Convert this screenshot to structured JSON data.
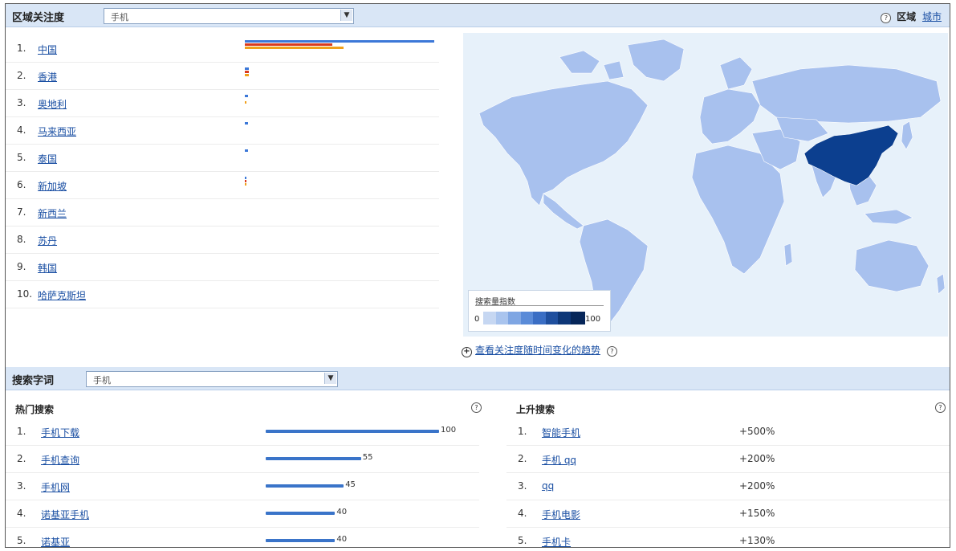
{
  "region_panel": {
    "title": "区域关注度",
    "select_value": "手机",
    "help_icon": "question-circle-icon",
    "toggle_current": "区域",
    "toggle_link": "城市",
    "regions": [
      {
        "rank": "1.",
        "name": "中国",
        "bars": [
          1.0,
          0.46,
          0.52
        ]
      },
      {
        "rank": "2.",
        "name": "香港",
        "bars": [
          0.02,
          0.02,
          0.02
        ]
      },
      {
        "rank": "3.",
        "name": "奥地利",
        "bars": [
          0.015,
          0,
          0.01
        ]
      },
      {
        "rank": "4.",
        "name": "马来西亚",
        "bars": [
          0.015,
          0,
          0
        ]
      },
      {
        "rank": "5.",
        "name": "泰国",
        "bars": [
          0.015,
          0,
          0
        ]
      },
      {
        "rank": "6.",
        "name": "新加坡",
        "bars": [
          0.01,
          0.005,
          0.01
        ]
      },
      {
        "rank": "7.",
        "name": "新西兰",
        "bars": [
          0,
          0,
          0
        ]
      },
      {
        "rank": "8.",
        "name": "苏丹",
        "bars": [
          0,
          0,
          0
        ]
      },
      {
        "rank": "9.",
        "name": "韩国",
        "bars": [
          0,
          0,
          0
        ]
      },
      {
        "rank": "10.",
        "name": "哈萨克斯坦",
        "bars": [
          0,
          0,
          0
        ]
      }
    ],
    "bar_colors": [
      "#3c78d8",
      "#d93a1f",
      "#f0a01b"
    ]
  },
  "map": {
    "legend_title": "搜索量指数",
    "legend_min": "0",
    "legend_max": "100",
    "legend_colors": [
      "#c6d7f2",
      "#a9c4ee",
      "#7fa6e3",
      "#5a8bd8",
      "#3a6ec4",
      "#1f4f9e",
      "#0d3778",
      "#062659"
    ],
    "trend_link": "查看关注度随时间变化的趋势",
    "expand_icon": "plus-circle-icon"
  },
  "search_panel": {
    "title": "搜索字词",
    "select_value": "手机",
    "hot": {
      "title": "热门搜索",
      "items": [
        {
          "rank": "1.",
          "term": "手机下载",
          "value": 100,
          "label": "100"
        },
        {
          "rank": "2.",
          "term": "手机查询",
          "value": 55,
          "label": "55"
        },
        {
          "rank": "3.",
          "term": "手机网",
          "value": 45,
          "label": "45"
        },
        {
          "rank": "4.",
          "term": "诺基亚手机",
          "value": 40,
          "label": "40"
        },
        {
          "rank": "5.",
          "term": "诺基亚",
          "value": 40,
          "label": "40"
        }
      ]
    },
    "rising": {
      "title": "上升搜索",
      "items": [
        {
          "rank": "1.",
          "term": "智能手机",
          "change": "+500%"
        },
        {
          "rank": "2.",
          "term": "手机 qq",
          "change": "+200%"
        },
        {
          "rank": "3.",
          "term": "qq",
          "change": "+200%"
        },
        {
          "rank": "4.",
          "term": "手机电影",
          "change": "+150%"
        },
        {
          "rank": "5.",
          "term": "手机卡",
          "change": "+130%"
        }
      ]
    }
  }
}
